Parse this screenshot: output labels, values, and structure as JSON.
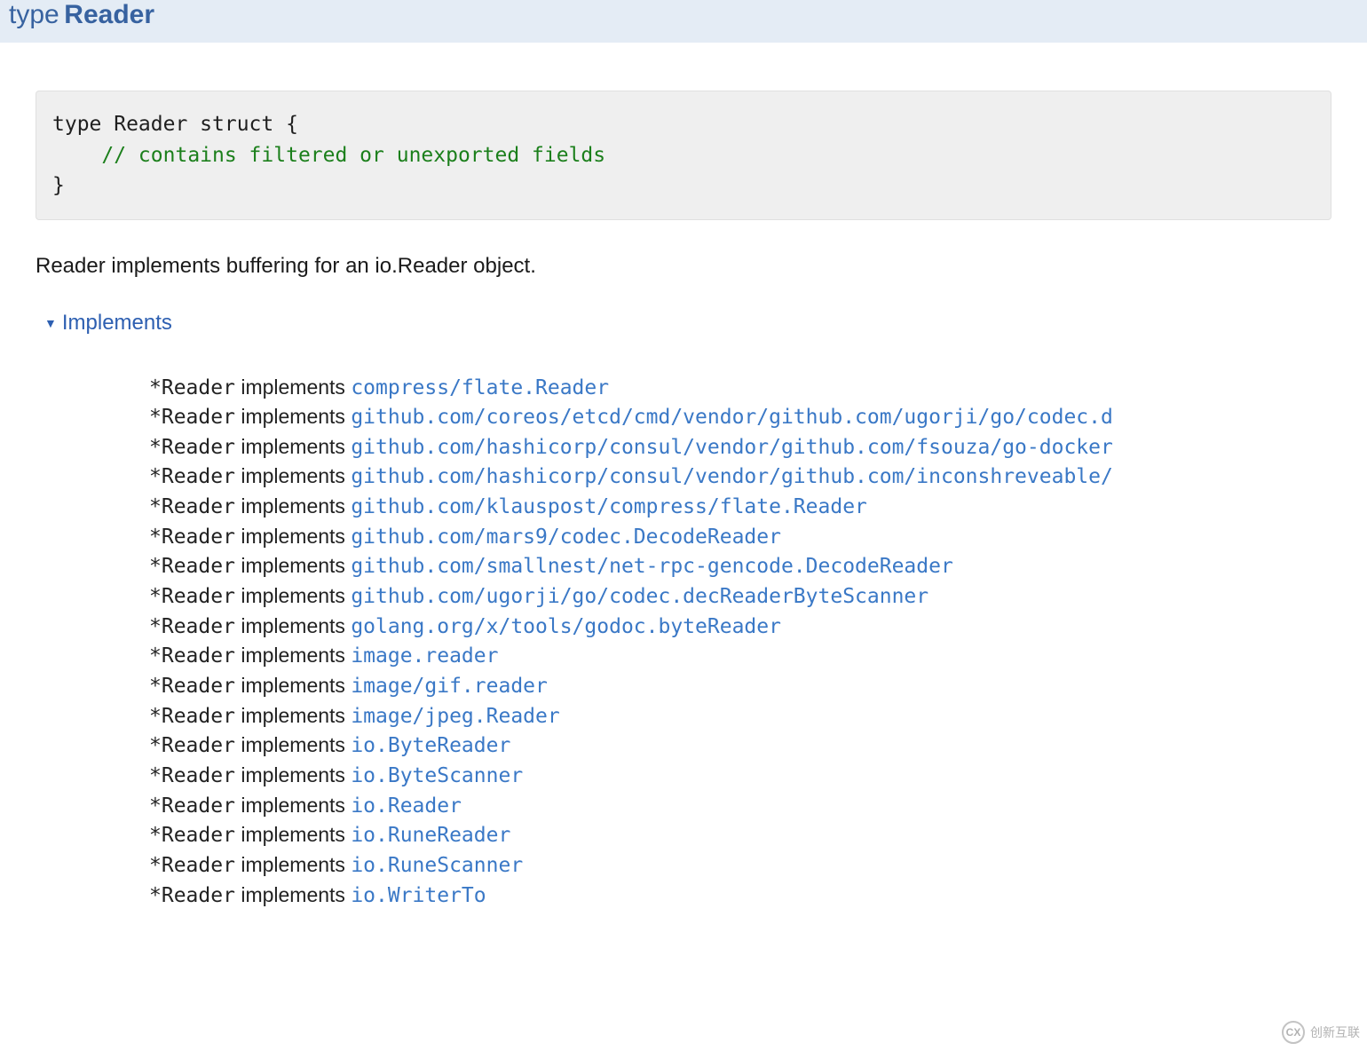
{
  "header": {
    "type_keyword": "type",
    "type_name": "Reader"
  },
  "code": {
    "line1": "type Reader struct {",
    "line2": "    // contains filtered or unexported fields",
    "line3": "}"
  },
  "description": "Reader implements buffering for an io.Reader object.",
  "implements_label": "Implements",
  "star_type": "*Reader",
  "implements_word": "implements",
  "interfaces": [
    "compress/flate.Reader",
    "github.com/coreos/etcd/cmd/vendor/github.com/ugorji/go/codec.d",
    "github.com/hashicorp/consul/vendor/github.com/fsouza/go-docker",
    "github.com/hashicorp/consul/vendor/github.com/inconshreveable/",
    "github.com/klauspost/compress/flate.Reader",
    "github.com/mars9/codec.DecodeReader",
    "github.com/smallnest/net-rpc-gencode.DecodeReader",
    "github.com/ugorji/go/codec.decReaderByteScanner",
    "golang.org/x/tools/godoc.byteReader",
    "image.reader",
    "image/gif.reader",
    "image/jpeg.Reader",
    "io.ByteReader",
    "io.ByteScanner",
    "io.Reader",
    "io.RuneReader",
    "io.RuneScanner",
    "io.WriterTo"
  ],
  "watermark": {
    "logo": "CX",
    "text": "创新互联"
  }
}
